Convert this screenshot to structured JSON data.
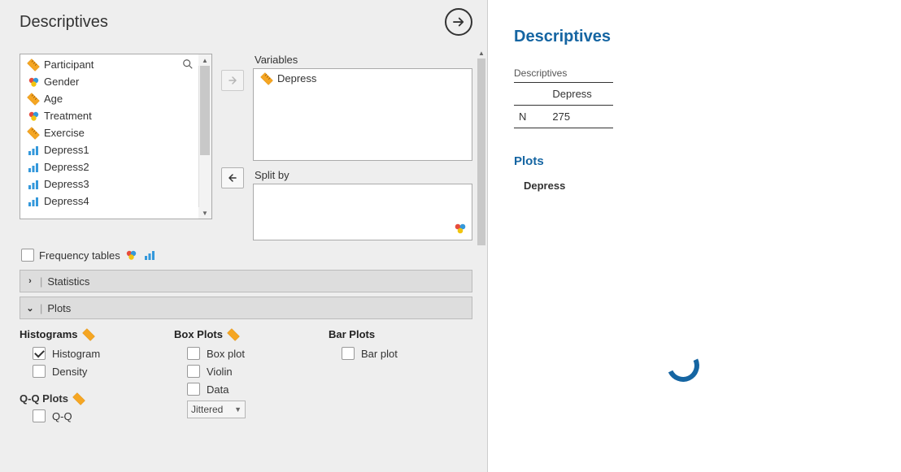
{
  "panel": {
    "title": "Descriptives",
    "freq_tables_label": "Frequency tables",
    "sections": {
      "statistics_label": "Statistics",
      "plots_label": "Plots"
    }
  },
  "available_vars": [
    {
      "name": "Participant",
      "icon": "scale"
    },
    {
      "name": "Gender",
      "icon": "nominal"
    },
    {
      "name": "Age",
      "icon": "scale"
    },
    {
      "name": "Treatment",
      "icon": "nominal"
    },
    {
      "name": "Exercise",
      "icon": "scale"
    },
    {
      "name": "Depress1",
      "icon": "ordinal"
    },
    {
      "name": "Depress2",
      "icon": "ordinal"
    },
    {
      "name": "Depress3",
      "icon": "ordinal"
    },
    {
      "name": "Depress4",
      "icon": "ordinal"
    }
  ],
  "variables_field": {
    "label": "Variables",
    "items": [
      {
        "name": "Depress",
        "icon": "scale"
      }
    ]
  },
  "splitby_field": {
    "label": "Split by"
  },
  "plots": {
    "histograms_label": "Histograms",
    "histogram": "Histogram",
    "density": "Density",
    "qq_label": "Q-Q Plots",
    "qq": "Q-Q",
    "box_label": "Box Plots",
    "boxplot": "Box plot",
    "violin": "Violin",
    "data": "Data",
    "jitter_select": "Jittered",
    "bar_label": "Bar Plots",
    "barplot": "Bar plot"
  },
  "results": {
    "title": "Descriptives",
    "table_caption": "Descriptives",
    "col_header": "Depress",
    "row_label": "N",
    "row_value": "275",
    "plots_heading": "Plots",
    "plot_var": "Depress"
  }
}
